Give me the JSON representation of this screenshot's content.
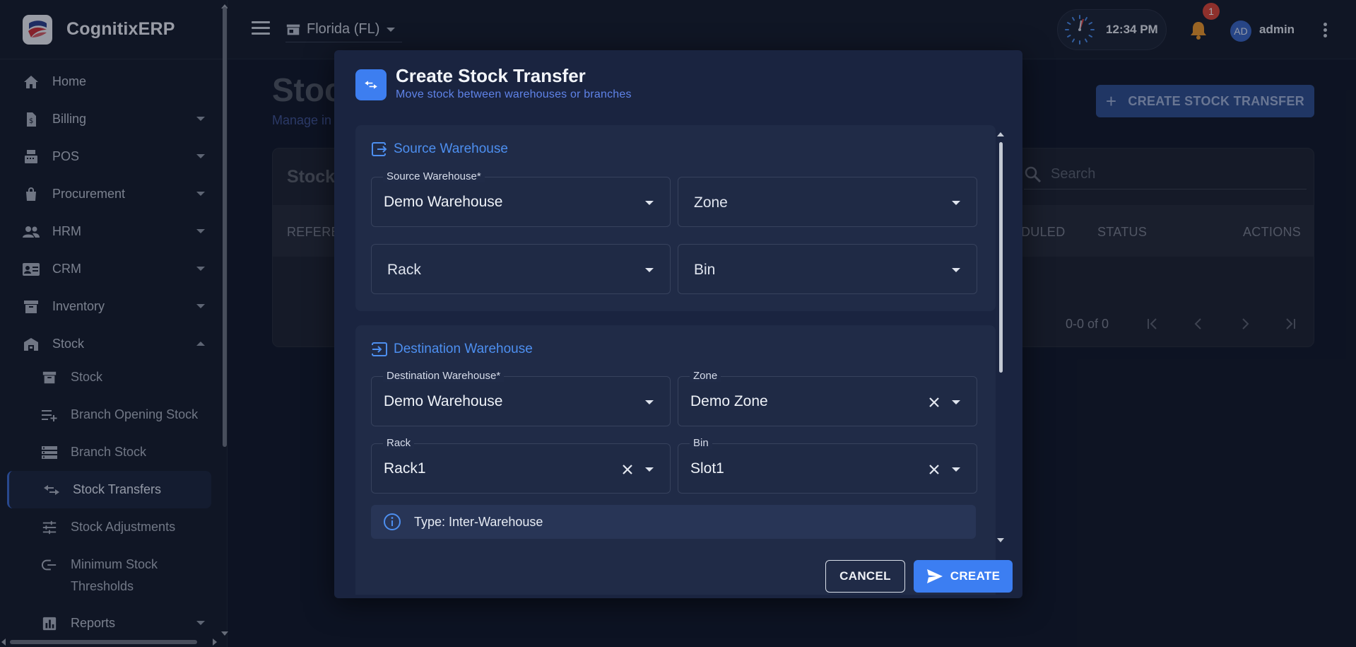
{
  "app": {
    "name": "CognitixERP"
  },
  "sidebar": {
    "items": [
      {
        "label": "Home",
        "icon": "home-icon",
        "expandable": false
      },
      {
        "label": "Billing",
        "icon": "invoice-icon",
        "expandable": true
      },
      {
        "label": "POS",
        "icon": "cash-register-icon",
        "expandable": true
      },
      {
        "label": "Procurement",
        "icon": "shopping-bag-icon",
        "expandable": true
      },
      {
        "label": "HRM",
        "icon": "people-icon",
        "expandable": true
      },
      {
        "label": "CRM",
        "icon": "contact-card-icon",
        "expandable": true
      },
      {
        "label": "Inventory",
        "icon": "archive-icon",
        "expandable": true
      },
      {
        "label": "Stock",
        "icon": "warehouse-icon",
        "expandable": true,
        "expanded": true
      }
    ],
    "stock_sub": [
      {
        "label": "Stock",
        "icon": "archive-icon"
      },
      {
        "label": "Branch Opening Stock",
        "icon": "playlist-add-icon"
      },
      {
        "label": "Branch Stock",
        "icon": "list-icon"
      },
      {
        "label": "Stock Transfers",
        "icon": "swap-icon",
        "active": true
      },
      {
        "label": "Stock Adjustments",
        "icon": "tune-icon"
      },
      {
        "label": "Minimum Stock",
        "label2": "Thresholds",
        "icon": "threshold-icon"
      }
    ],
    "reports": {
      "label": "Reports",
      "icon": "bar-chart-icon"
    }
  },
  "topbar": {
    "branch": "Florida (FL)",
    "time": "12:34 PM",
    "notification_count": "1",
    "avatar_initials": "AD",
    "user": "admin"
  },
  "page": {
    "title": "Stoc",
    "subtitle": "Manage in",
    "create_button": "CREATE STOCK TRANSFER",
    "card_title": "Stock",
    "search_placeholder": "Search",
    "columns": {
      "reference": "REFERE",
      "scheduled": "DULED",
      "status": "STATUS",
      "actions": "ACTIONS"
    },
    "pagination": "0-0 of 0"
  },
  "dialog": {
    "title": "Create Stock Transfer",
    "subtitle": "Move stock between warehouses or branches",
    "source": {
      "heading": "Source Warehouse",
      "warehouse_label": "Source Warehouse*",
      "warehouse_value": "Demo Warehouse",
      "zone_placeholder": "Zone",
      "rack_placeholder": "Rack",
      "bin_placeholder": "Bin"
    },
    "destination": {
      "heading": "Destination Warehouse",
      "warehouse_label": "Destination Warehouse*",
      "warehouse_value": "Demo Warehouse",
      "zone_label": "Zone",
      "zone_value": "Demo Zone",
      "rack_label": "Rack",
      "rack_value": "Rack1",
      "bin_label": "Bin",
      "bin_value": "Slot1"
    },
    "info": "Type: Inter-Warehouse",
    "cancel": "CANCEL",
    "create": "CREATE"
  },
  "colors": {
    "accent": "#3c7ef2",
    "heading_blue": "#4d8ff0",
    "badge": "#d8453a"
  }
}
